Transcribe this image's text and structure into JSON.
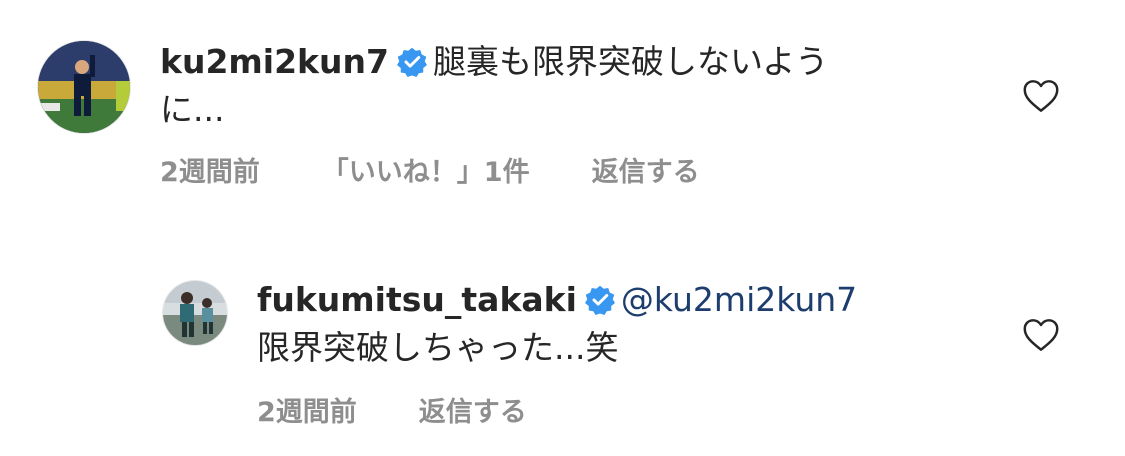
{
  "comments": [
    {
      "username": "ku2mi2kun7",
      "verified": true,
      "text_line1": "腿裏も限界突破しないよう",
      "text_line2": "に...",
      "time": "2週間前",
      "likes": "「いいね！」1件",
      "reply": "返信する",
      "avatar_icon": "avatar-photo-soccer-player",
      "like_icon": "heart-outline-icon"
    },
    {
      "username": "fukumitsu_takaki",
      "verified": true,
      "mention": "@ku2mi2kun7",
      "text_line2": "限界突破しちゃった...笑",
      "time": "2週間前",
      "reply": "返信する",
      "avatar_icon": "avatar-photo-training",
      "like_icon": "heart-outline-icon"
    }
  ],
  "colors": {
    "text": "#262626",
    "meta": "#8e8e8e",
    "mention": "#1c3d6e",
    "verified": "#3897f0"
  }
}
